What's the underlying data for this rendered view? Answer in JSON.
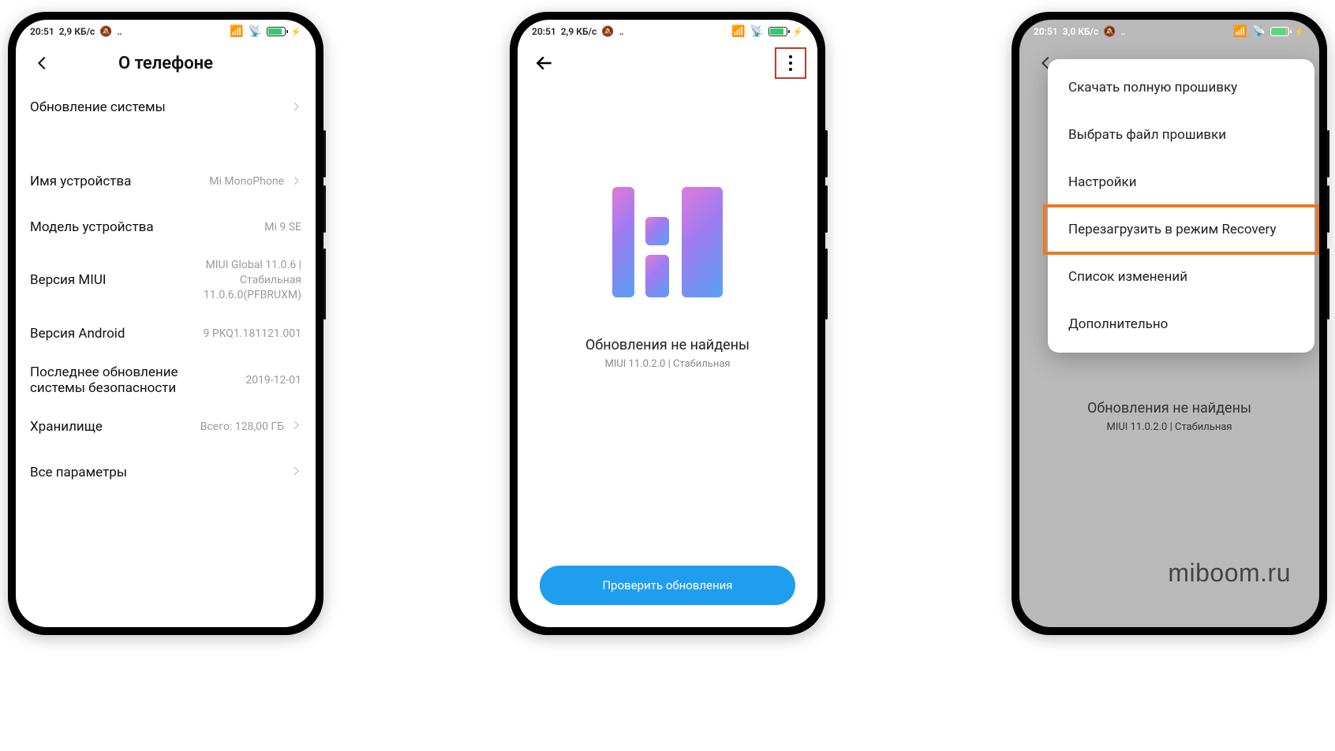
{
  "phone1": {
    "status": {
      "time": "20:51",
      "data": "2,9 КБ/с",
      "battery_pct": "79"
    },
    "title": "О телефоне",
    "rows": {
      "system_update": {
        "label": "Обновление системы"
      },
      "device_name": {
        "label": "Имя устройства",
        "value": "Mi MonoPhone"
      },
      "model": {
        "label": "Модель устройства",
        "value": "Mi 9 SE"
      },
      "miui": {
        "label": "Версия MIUI",
        "value_l1": "MIUI Global 11.0.6 |",
        "value_l2": "Стабильная",
        "value_l3": "11.0.6.0(PFBRUXM)"
      },
      "android": {
        "label": "Версия Android",
        "value": "9 PKQ1.181121.001"
      },
      "security": {
        "label": "Последнее обновление системы безопасности",
        "value": "2019-12-01"
      },
      "storage": {
        "label": "Хранилище",
        "value": "Всего: 128,00 ГБ"
      },
      "all_params": {
        "label": "Все параметры"
      }
    }
  },
  "phone2": {
    "status": {
      "time": "20:51",
      "data": "2,9 КБ/с",
      "battery_pct": "79"
    },
    "update_title": "Обновления не найдены",
    "update_sub": "MIUI 11.0.2.0 | Стабильная",
    "check_button": "Проверить обновления"
  },
  "phone3": {
    "status": {
      "time": "20:51",
      "data": "3,0 КБ/с",
      "battery_pct": "79"
    },
    "menu": {
      "download_full": "Скачать полную прошивку",
      "choose_file": "Выбрать файл прошивки",
      "settings": "Настройки",
      "reboot_recovery": "Перезагрузить в режим Recovery",
      "changelog": "Список изменений",
      "more": "Дополнительно"
    },
    "update_title": "Обновления не найдены",
    "update_sub": "MIUI 11.0.2.0 | Стабильная",
    "watermark": "miboom.ru"
  }
}
